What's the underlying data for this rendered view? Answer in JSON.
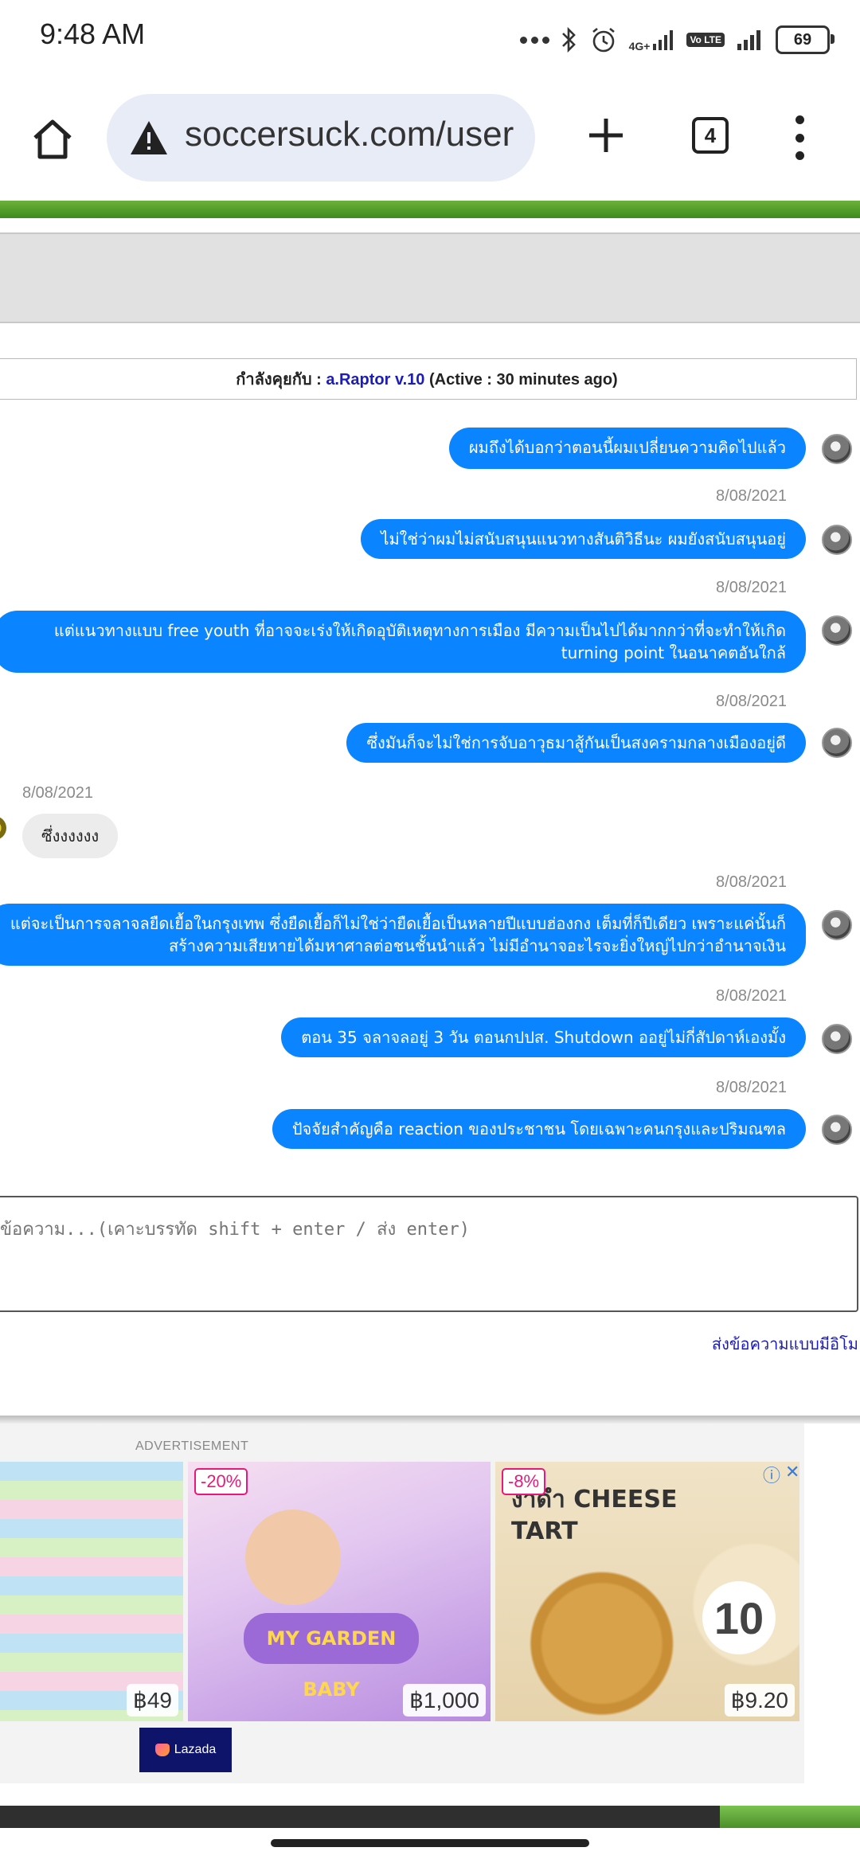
{
  "status_bar": {
    "time": "9:48 AM",
    "network": "4G+",
    "volte": "Vo LTE",
    "battery": "69"
  },
  "browser": {
    "url": "soccersuck.com/user",
    "tab_count": "4"
  },
  "chat": {
    "header_prefix": "กำลังคุยกับ :",
    "partner_name": "a.Raptor v.10",
    "status": "(Active : 30 minutes ago)",
    "messages": [
      {
        "text": "ผมถึงได้บอกว่าตอนนี้ผมเปลี่ยนความคิดไปแล้ว",
        "date": "8/08/2021"
      },
      {
        "text": "ไม่ใช่ว่าผมไม่สนับสนุนแนวทางสันติวิธีนะ ผมยังสนับสนุนอยู่",
        "date": "8/08/2021"
      },
      {
        "text": "แต่แนวทางแบบ free youth ที่อาจจะเร่งให้เกิดอุบัติเหตุทางการเมือง มีความเป็นไปได้มากกว่าที่จะทำให้เกิด turning point ในอนาคตอันใกล้",
        "date": "8/08/2021"
      },
      {
        "text": "ซึ่งมันก็จะไม่ใช่การจับอาวุธมาสู้กันเป็นสงครามกลางเมืองอยู่ดี",
        "date": "8/08/2021"
      },
      {
        "text": "แต่จะเป็นการจลาจลยืดเยื้อในกรุงเทพ ซึ่งยืดเยื้อก็ไม่ใช่ว่ายืดเยื้อเป็นหลายปีแบบฮ่องกง เต็มที่ก็ปีเดียว เพราะแค่นั้นก็สร้างความเสียหายได้มหาศาลต่อชนชั้นนำแล้ว ไม่มีอำนาจอะไรจะยิ่งใหญ่ไปกว่าอำนาจเงิน",
        "date": "8/08/2021"
      },
      {
        "text": "ตอน 35 จลาจลอยู่ 3 วัน ตอนกปปส. Shutdown ออยู่ไม่กี่สัปดาห์เองมั้ง",
        "date": "8/08/2021"
      },
      {
        "text": "ปัจจัยสำคัญคือ reaction ของประชาชน โดยเฉพาะคนกรุงและปริมณฑล",
        "date": "8/08/2021"
      }
    ],
    "incoming": {
      "date": "8/08/2021",
      "text": "ซึ่งงงงงง"
    },
    "compose_placeholder": "ข้อความ...(เคาะบรรทัด shift + enter / ส่ง enter)",
    "emoji_link": "ส่งข้อความแบบมีอิโม"
  },
  "ad": {
    "label": "ADVERTISEMENT",
    "items": [
      {
        "price": "฿49"
      },
      {
        "badge": "-20%",
        "price": "฿1,000",
        "product_text": "MY GARDEN BABY"
      },
      {
        "badge": "-8%",
        "price": "฿9.20",
        "product_text": "งาดำ CHEESE TART",
        "count": "10"
      }
    ],
    "brand": "Lazada"
  },
  "colors": {
    "bubble": "#0a84ff",
    "link": "#1c1cb8",
    "accent_green": "#4c8f2a"
  }
}
